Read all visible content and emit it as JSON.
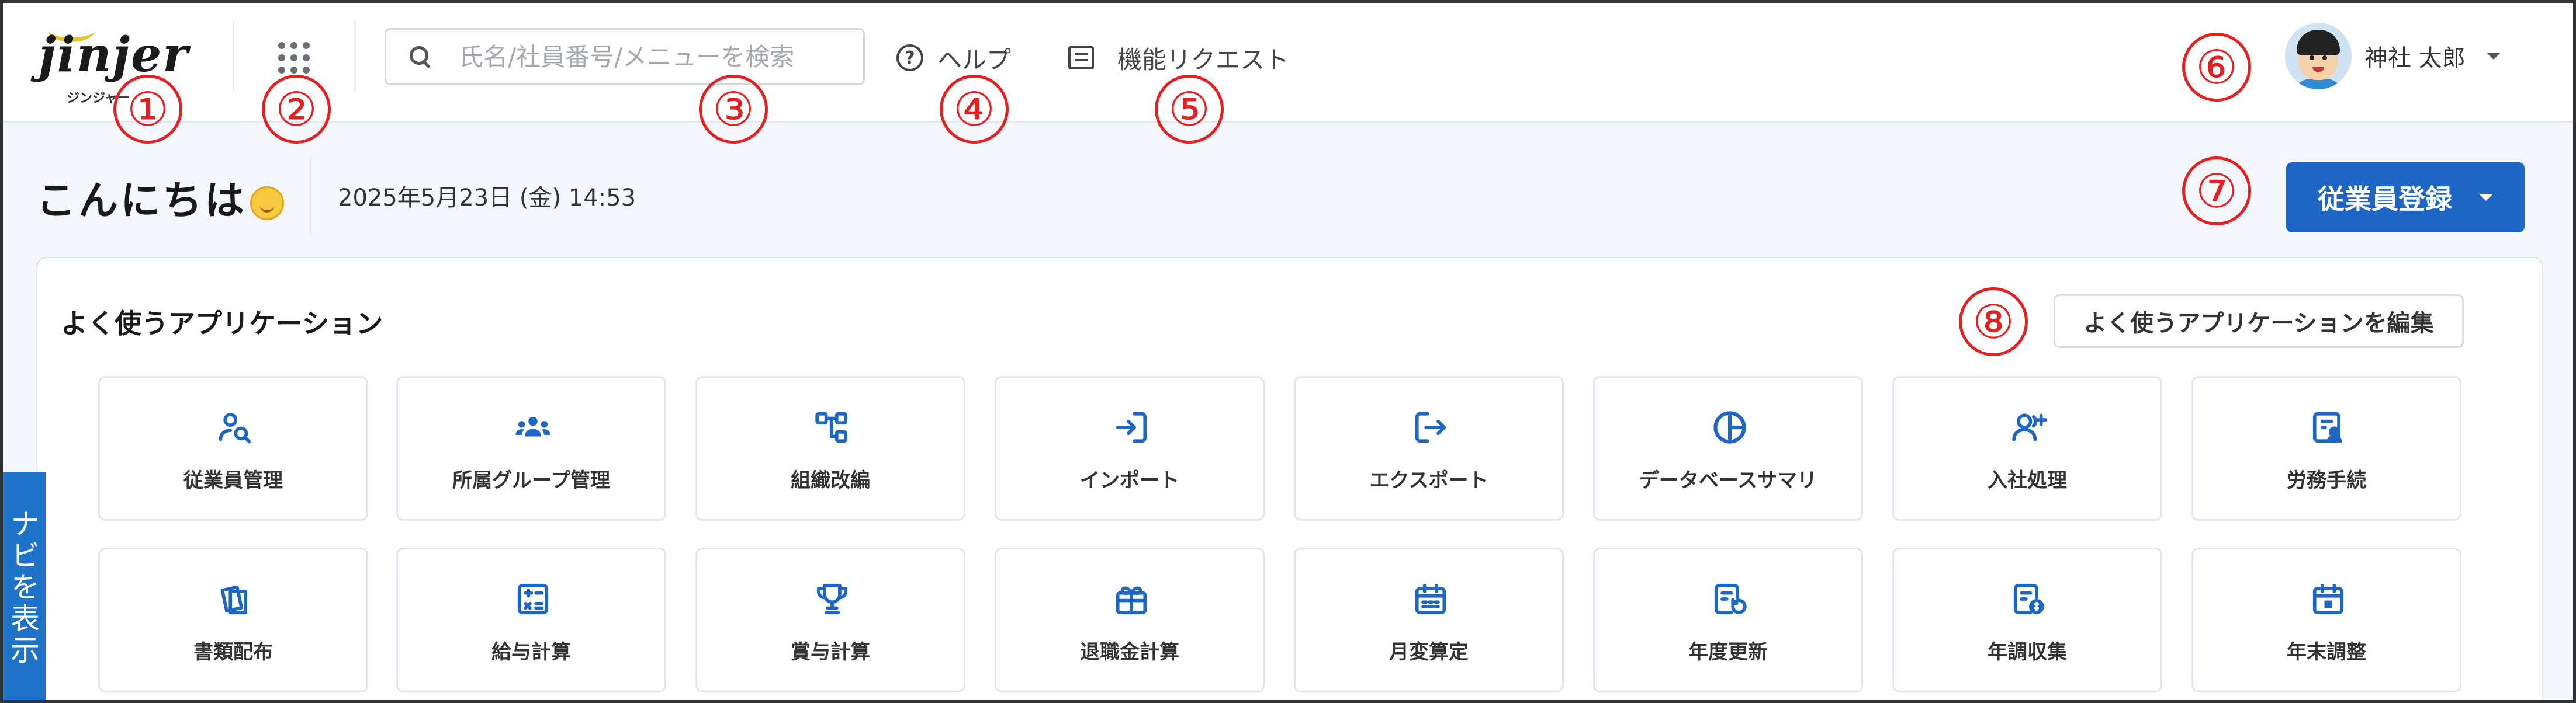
{
  "header": {
    "logo": {
      "text": "jinjer",
      "sub": "ジンジャー"
    },
    "search": {
      "placeholder": "氏名/社員番号/メニューを検索"
    },
    "help_label": "ヘルプ",
    "request_label": "機能リクエスト",
    "user_name": "神社 太郎"
  },
  "markers": [
    "①",
    "②",
    "③",
    "④",
    "⑤",
    "⑥",
    "⑦",
    "⑧"
  ],
  "greeting": {
    "text": "こんにちは",
    "datetime": "2025年5月23日 (金) 14:53"
  },
  "register_button": "従業員登録",
  "apps_card": {
    "title": "よく使うアプリケーション",
    "edit_label": "よく使うアプリケーションを編集",
    "tiles": [
      {
        "label": "従業員管理",
        "icon": "employee-search-icon"
      },
      {
        "label": "所属グループ管理",
        "icon": "group-icon"
      },
      {
        "label": "組織改編",
        "icon": "org-chart-icon"
      },
      {
        "label": "インポート",
        "icon": "import-icon"
      },
      {
        "label": "エクスポート",
        "icon": "export-icon"
      },
      {
        "label": "データベースサマリ",
        "icon": "pie-chart-icon"
      },
      {
        "label": "入社処理",
        "icon": "user-add-icon"
      },
      {
        "label": "労務手続",
        "icon": "labor-procedure-icon"
      },
      {
        "label": "書類配布",
        "icon": "documents-icon"
      },
      {
        "label": "給与計算",
        "icon": "calculator-icon"
      },
      {
        "label": "賞与計算",
        "icon": "trophy-icon"
      },
      {
        "label": "退職金計算",
        "icon": "gift-icon"
      },
      {
        "label": "月変算定",
        "icon": "calendar-icon"
      },
      {
        "label": "年度更新",
        "icon": "document-refresh-icon"
      },
      {
        "label": "年調収集",
        "icon": "document-money-icon"
      },
      {
        "label": "年末調整",
        "icon": "calendar-check-icon"
      }
    ]
  },
  "nav_tab": "ナビを表示",
  "colors": {
    "accent": "#1e66c4",
    "marker": "#e62020",
    "icon": "#1e66c4"
  }
}
